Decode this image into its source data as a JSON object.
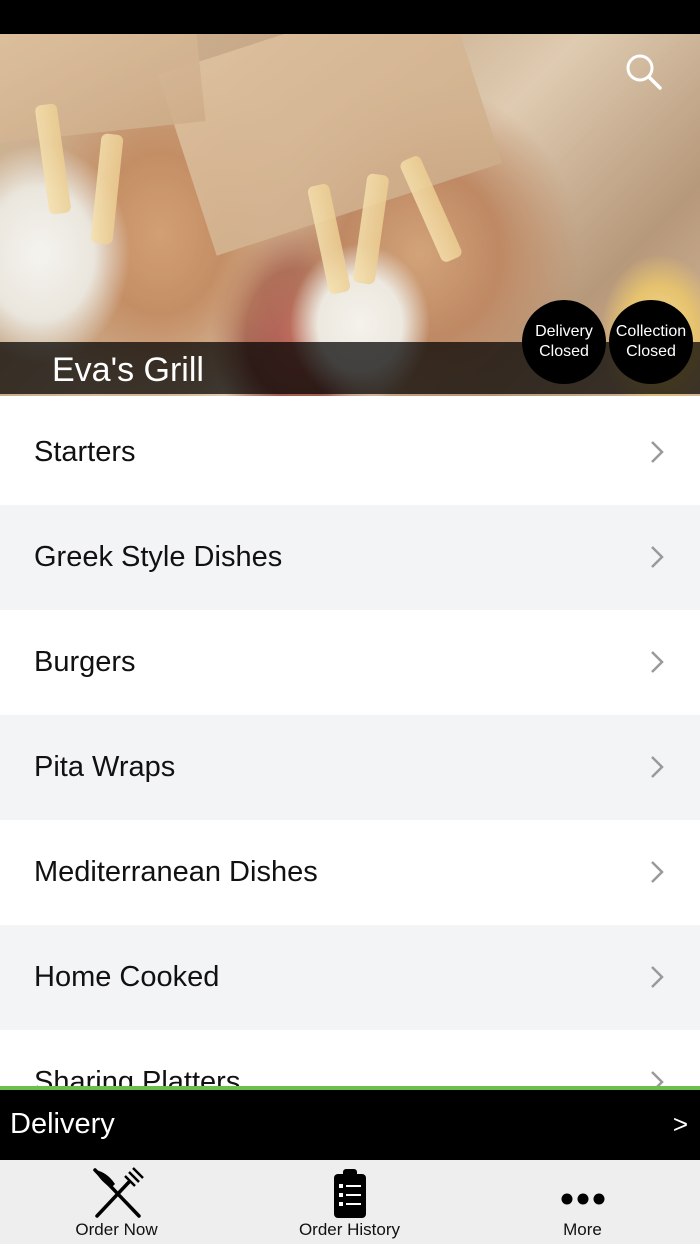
{
  "restaurant": {
    "name": "Eva's Grill"
  },
  "status_badges": {
    "delivery": {
      "line1": "Delivery",
      "line2": "Closed"
    },
    "collection": {
      "line1": "Collection",
      "line2": "Closed"
    }
  },
  "menu": {
    "categories": [
      {
        "label": "Starters"
      },
      {
        "label": "Greek Style Dishes"
      },
      {
        "label": "Burgers"
      },
      {
        "label": "Pita Wraps"
      },
      {
        "label": "Mediterranean Dishes"
      },
      {
        "label": "Home Cooked"
      },
      {
        "label": "Sharing Platters"
      }
    ]
  },
  "order_mode": {
    "label": "Delivery",
    "arrow": ">"
  },
  "tabs": [
    {
      "label": "Order Now",
      "icon": "fork-knife-icon"
    },
    {
      "label": "Order History",
      "icon": "clipboard-list-icon"
    },
    {
      "label": "More",
      "icon": "more-dots-icon"
    }
  ],
  "colors": {
    "accent_green": "#6cc04a",
    "bar_black": "#000000",
    "row_alt": "#f3f4f6",
    "tab_bg": "#eeeeee"
  }
}
